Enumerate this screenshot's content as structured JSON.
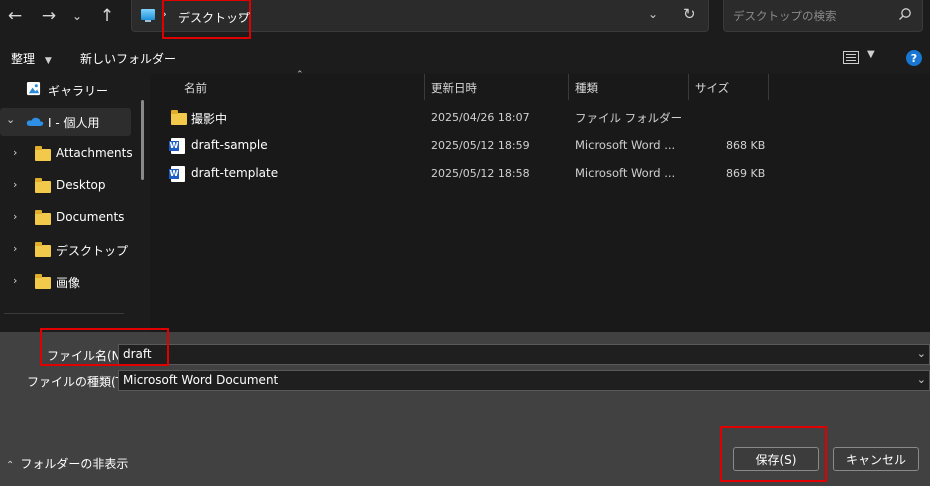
{
  "address_bar": {
    "current_folder": "デスクトップ",
    "search_placeholder": "デスクトップの検索"
  },
  "toolbar": {
    "organize_label": "整理",
    "new_folder_label": "新しいフォルダー"
  },
  "nav": {
    "items": [
      {
        "label": "ギャラリー"
      },
      {
        "label": "I - 個人用"
      },
      {
        "label": "Attachments"
      },
      {
        "label": "Desktop"
      },
      {
        "label": "Documents"
      },
      {
        "label": "デスクトップ"
      },
      {
        "label": "画像"
      }
    ]
  },
  "file_list": {
    "columns": {
      "name": "名前",
      "modified": "更新日時",
      "type": "種類",
      "size": "サイズ"
    },
    "rows": [
      {
        "name": "撮影中",
        "modified": "2025/04/26 18:07",
        "type": "ファイル フォルダー",
        "size": ""
      },
      {
        "name": "draft-sample",
        "modified": "2025/05/12 18:59",
        "type": "Microsoft Word ...",
        "size": "868 KB"
      },
      {
        "name": "draft-template",
        "modified": "2025/05/12 18:58",
        "type": "Microsoft Word ...",
        "size": "869 KB"
      }
    ]
  },
  "save_panel": {
    "filename_label": "ファイル名(N):",
    "filename_value": "draft",
    "filetype_label": "ファイルの種類(T):",
    "filetype_value": "Microsoft Word Document",
    "hide_folders_label": "フォルダーの非表示",
    "save_button": "保存(S)",
    "cancel_button": "キャンセル"
  },
  "colors": {
    "background": "#1c1c1c",
    "bottom_panel": "#414141",
    "highlight_box": "#e00000",
    "folder": "#f3c94c",
    "accent": "#1976d2"
  }
}
